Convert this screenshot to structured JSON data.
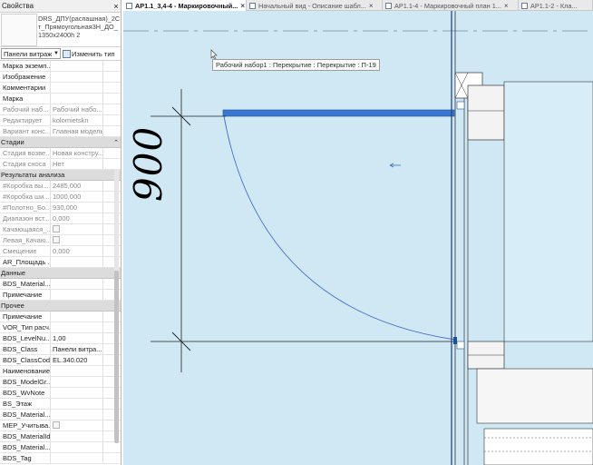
{
  "properties": {
    "title": "Свойства",
    "close_icon": "×",
    "type_name": "DRS_ДПУ(распашная)_2Ст_Прямоугольная3Н_ДО_1350х2400h 2",
    "type_selector": "Панели витраж",
    "edit_type": "Изменить тип",
    "rows_top": [
      {
        "name": "Марка экземп...",
        "value": ""
      },
      {
        "name": "Изображение",
        "value": ""
      },
      {
        "name": "Комментарии",
        "value": ""
      },
      {
        "name": "Марка",
        "value": ""
      },
      {
        "name": "Рабочий наб...",
        "value": "Рабочий набо..."
      },
      {
        "name": "Редактирует",
        "value": "kolomietskn"
      },
      {
        "name": "Вариант конс...",
        "value": "Главная модель"
      }
    ],
    "section_stages": "Стадии",
    "rows_stages": [
      {
        "name": "Стадия возве...",
        "value": "Новая констру..."
      },
      {
        "name": "Стадия сноса",
        "value": "Нет"
      }
    ],
    "section_analysis": "Результаты анализа",
    "rows_analysis": [
      {
        "name": "#Коробка вы...",
        "value": "2485,000"
      },
      {
        "name": "#Коробка ши...",
        "value": "1000,000"
      },
      {
        "name": "#Полотно_Бо...",
        "value": "930,000"
      },
      {
        "name": "Диапазон вст...",
        "value": "0,000"
      },
      {
        "name": "Качающаяся_...",
        "value": ""
      },
      {
        "name": "Левая_Качаю...",
        "value": ""
      },
      {
        "name": "Смещение",
        "value": "0,000"
      },
      {
        "name": "AR_Площадь ...",
        "value": ""
      }
    ],
    "section_data": "Данные",
    "rows_data": [
      {
        "name": "BDS_Material...",
        "value": ""
      },
      {
        "name": "Примечание",
        "value": ""
      }
    ],
    "section_other": "Прочее",
    "rows_other": [
      {
        "name": "Примечание",
        "value": ""
      },
      {
        "name": "VOR_Тип расч...",
        "value": ""
      },
      {
        "name": "BDS_LevelNu...",
        "value": "1,00"
      },
      {
        "name": "BDS_Class",
        "value": "Панели витра..."
      },
      {
        "name": "BDS_ClassCode",
        "value": "EL.340.020"
      },
      {
        "name": "Наименование",
        "value": ""
      },
      {
        "name": "BDS_ModelGr...",
        "value": ""
      },
      {
        "name": "BDS_WvNote",
        "value": ""
      },
      {
        "name": "BS_Этаж",
        "value": ""
      },
      {
        "name": "BDS_Material...",
        "value": ""
      },
      {
        "name": "MEP_Учитыва...",
        "value": ""
      },
      {
        "name": "BDS_MaterialId",
        "value": ""
      },
      {
        "name": "BDS_Material...",
        "value": ""
      },
      {
        "name": "BDS_Tag",
        "value": ""
      }
    ]
  },
  "tabs": [
    {
      "label": "АР1.1_3,4-4 - Маркировочный...",
      "active": true,
      "icon": "floor-plan-icon"
    },
    {
      "label": "Начальный вид - Описание шабл...",
      "active": false,
      "icon": "view-icon"
    },
    {
      "label": "АР1.1-4 - Маркировочный план 1...",
      "active": false,
      "icon": "floor-plan-icon"
    },
    {
      "label": "АР1.1-2 - Кла...",
      "active": false,
      "icon": "floor-plan-icon"
    }
  ],
  "tab_close": "×",
  "canvas": {
    "tooltip": "Рабочий набор1 : Перекрытие : Перекрытие : П-19",
    "dimension": "900",
    "background": "#cfe8f4",
    "selection_color": "#3a78d0"
  }
}
